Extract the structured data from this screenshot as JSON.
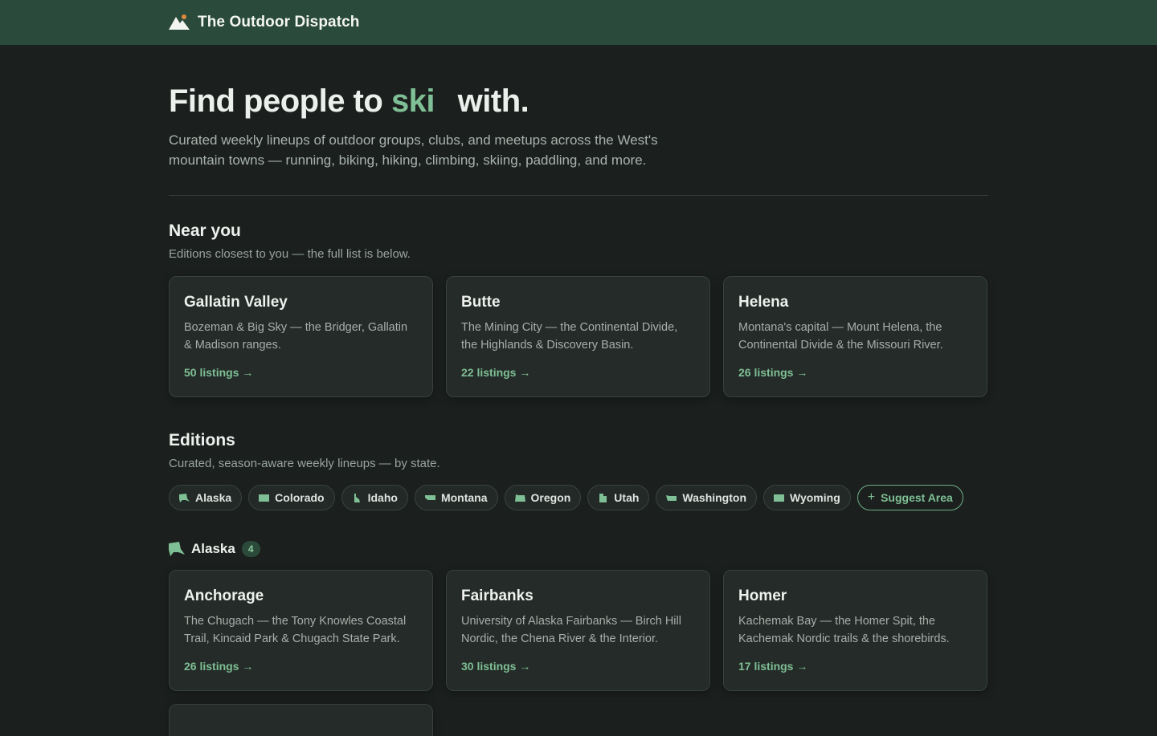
{
  "header": {
    "brand": "The Outdoor Dispatch",
    "logo_icon": "mountain-icon"
  },
  "hero": {
    "title_before": "Find people to",
    "title_accent": "ski",
    "title_after": "with.",
    "lead": "Curated weekly lineups of outdoor groups, clubs, and meetups across the West's mountain towns — running, biking, hiking, climbing, skiing, paddling, and more."
  },
  "near_you": {
    "title": "Near you",
    "subtitle": "Editions closest to you — the full list is below.",
    "cards": [
      {
        "title": "Gallatin Valley",
        "desc": "Bozeman & Big Sky — the Bridger, Gallatin & Madison ranges.",
        "link": "50 listings →"
      },
      {
        "title": "Butte",
        "desc": "The Mining City — the Continental Divide, the Highlands & Discovery Basin.",
        "link": "22 listings →"
      },
      {
        "title": "Helena",
        "desc": "Montana's capital — Mount Helena, the Continental Divide & the Missouri River.",
        "link": "26 listings →"
      }
    ]
  },
  "editions": {
    "title": "Editions",
    "subtitle": "Curated, season-aware weekly lineups — by state.",
    "chips": [
      "Alaska",
      "Colorado",
      "Idaho",
      "Montana",
      "Oregon",
      "Utah",
      "Washington",
      "Wyoming"
    ],
    "suggest_label": "Suggest Area"
  },
  "alaska": {
    "name": "Alaska",
    "count": "4",
    "cards": [
      {
        "title": "Anchorage",
        "desc": "The Chugach — the Tony Knowles Coastal Trail, Kincaid Park & Chugach State Park.",
        "link": "26 listings →"
      },
      {
        "title": "Fairbanks",
        "desc": "University of Alaska Fairbanks — Birch Hill Nordic, the Chena River & the Interior.",
        "link": "30 listings →"
      },
      {
        "title": "Homer",
        "desc": "Kachemak Bay — the Homer Spit, the Kachemak Nordic trails & the shorebirds.",
        "link": "17 listings →"
      }
    ]
  },
  "colors": {
    "accent": "#7fbf95",
    "header_bg": "#2a4a3b",
    "page_bg": "#1b201e",
    "card_bg": "#242b28"
  }
}
